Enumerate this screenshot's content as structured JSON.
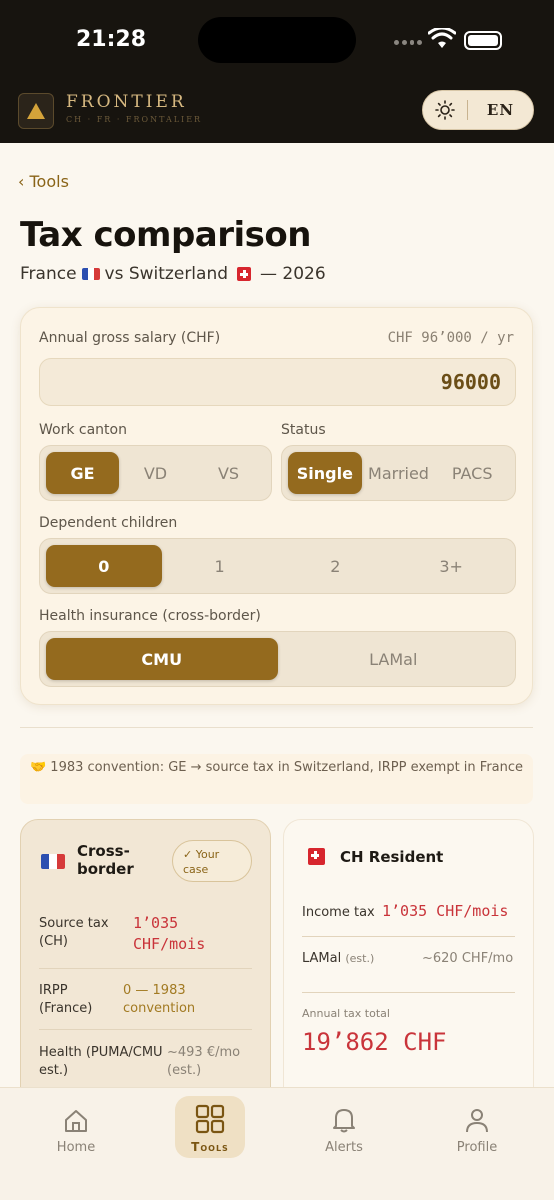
{
  "status_bar": {
    "time": "21:28"
  },
  "header": {
    "brand": "FRONTIER",
    "brand_sub": "CH · FR · FRONTALIER",
    "language": "EN"
  },
  "nav": {
    "back_label": "Tools"
  },
  "page": {
    "title": "Tax comparison",
    "subtitle_country_a": "France",
    "subtitle_vs": "vs Switzerland",
    "subtitle_year": "— 2026"
  },
  "form": {
    "salary_label": "Annual gross salary (CHF)",
    "salary_readout": "CHF 96’000 / yr",
    "salary_value": "96000",
    "canton_label": "Work canton",
    "cantons": [
      "GE",
      "VD",
      "VS"
    ],
    "canton_selected": "GE",
    "status_label": "Status",
    "statuses": [
      "Single",
      "Married",
      "PACS"
    ],
    "status_selected": "Single",
    "children_label": "Dependent children",
    "children": [
      "0",
      "1",
      "2",
      "3+"
    ],
    "children_selected": "0",
    "health_label": "Health insurance (cross-border)",
    "health_options": [
      "CMU",
      "LAMal"
    ],
    "health_selected": "CMU"
  },
  "convention_note": "🤝 1983 convention: GE → source tax in Switzerland, IRPP exempt in France",
  "cross_border": {
    "title": "Cross-border",
    "badge": "✓ Your case",
    "rows": [
      {
        "label": "Source tax (CH)",
        "value": "1’035 CHF/mois"
      },
      {
        "label": "IRPP (France)",
        "value": "0 — 1983 convention"
      },
      {
        "label": "Health (PUMA/CMU est.)",
        "value": "~493 €/mo (est.)"
      }
    ]
  },
  "ch_resident": {
    "title": "CH Resident",
    "income_tax_label": "Income tax",
    "income_tax_value": "1’035 CHF/mois",
    "lamal_label": "LAMal",
    "lamal_note": "(est.)",
    "lamal_value": "~620 CHF/mo",
    "annual_total_label": "Annual tax total",
    "annual_total_value": "19’862 CHF"
  },
  "tabs": [
    {
      "label": "Home",
      "icon": "home-icon"
    },
    {
      "label": "Tools",
      "icon": "grid-icon"
    },
    {
      "label": "Alerts",
      "icon": "bell-icon"
    },
    {
      "label": "Profile",
      "icon": "user-icon"
    }
  ],
  "colors": {
    "accent": "#946a1e",
    "dark": "#17140f",
    "red_value": "#c9343a"
  }
}
